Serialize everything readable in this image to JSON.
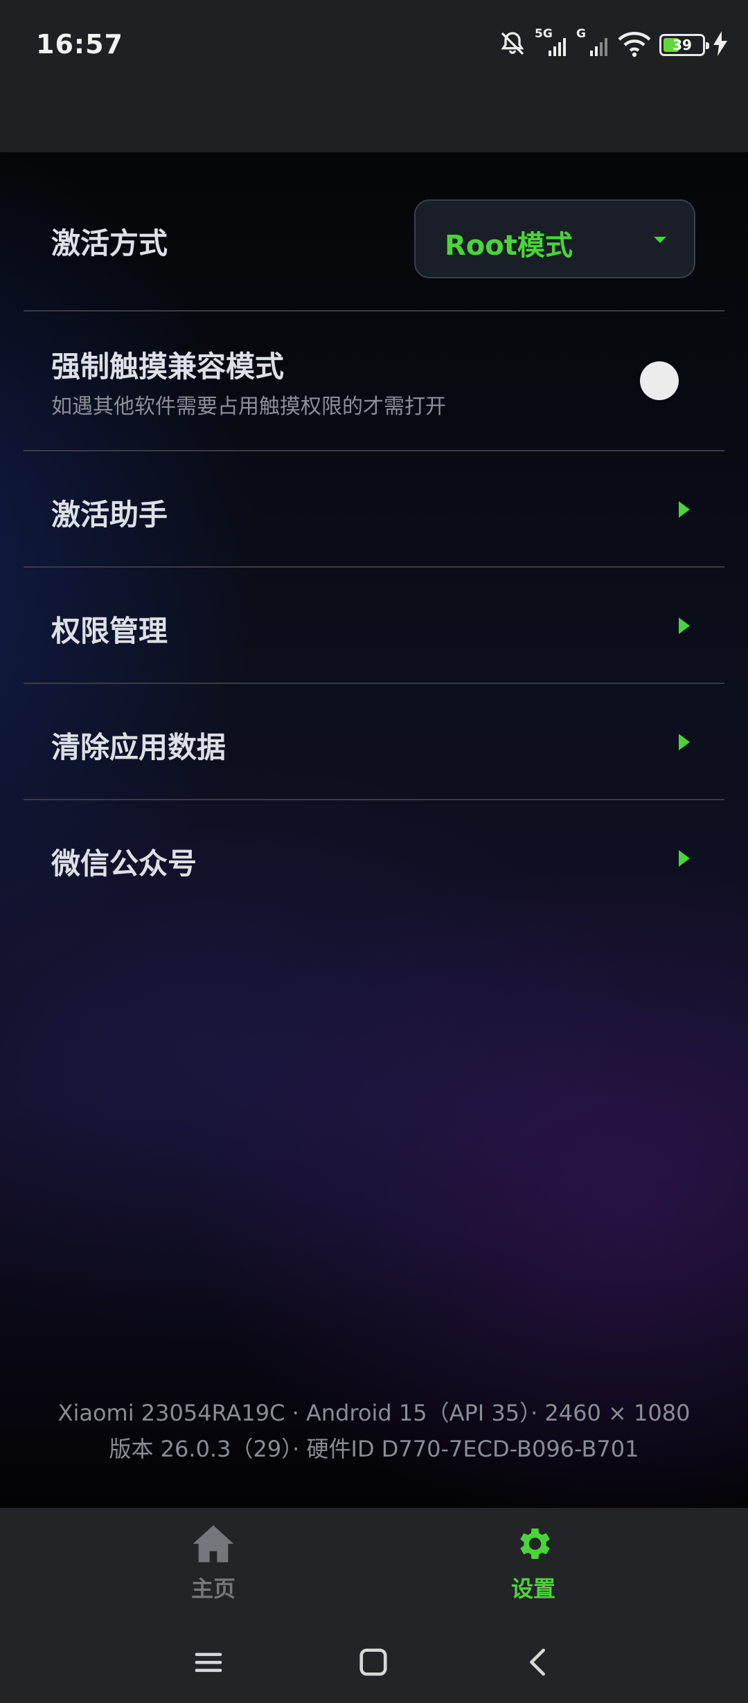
{
  "status_bar": {
    "time": "16:57",
    "network_1": "5G",
    "network_2": "G",
    "battery": "39"
  },
  "settings": {
    "activation_mode": {
      "label": "激活方式",
      "value": "Root模式"
    },
    "force_touch": {
      "label": "强制触摸兼容模式",
      "description": "如遇其他软件需要占用触摸权限的才需打开",
      "enabled": false
    },
    "items": [
      {
        "label": "激活助手"
      },
      {
        "label": "权限管理"
      },
      {
        "label": "清除应用数据"
      },
      {
        "label": "微信公众号"
      }
    ]
  },
  "device_info": {
    "line1": "Xiaomi 23054RA19C  ·  Android 15（API 35）·  2460 × 1080",
    "line2": "版本 26.0.3（29）·  硬件ID D770-7ECD-B096-B701"
  },
  "bottom_nav": {
    "home": "主页",
    "settings": "设置"
  },
  "colors": {
    "accent": "#4bd43a",
    "background": "#000000",
    "nav_bg": "#232427"
  }
}
